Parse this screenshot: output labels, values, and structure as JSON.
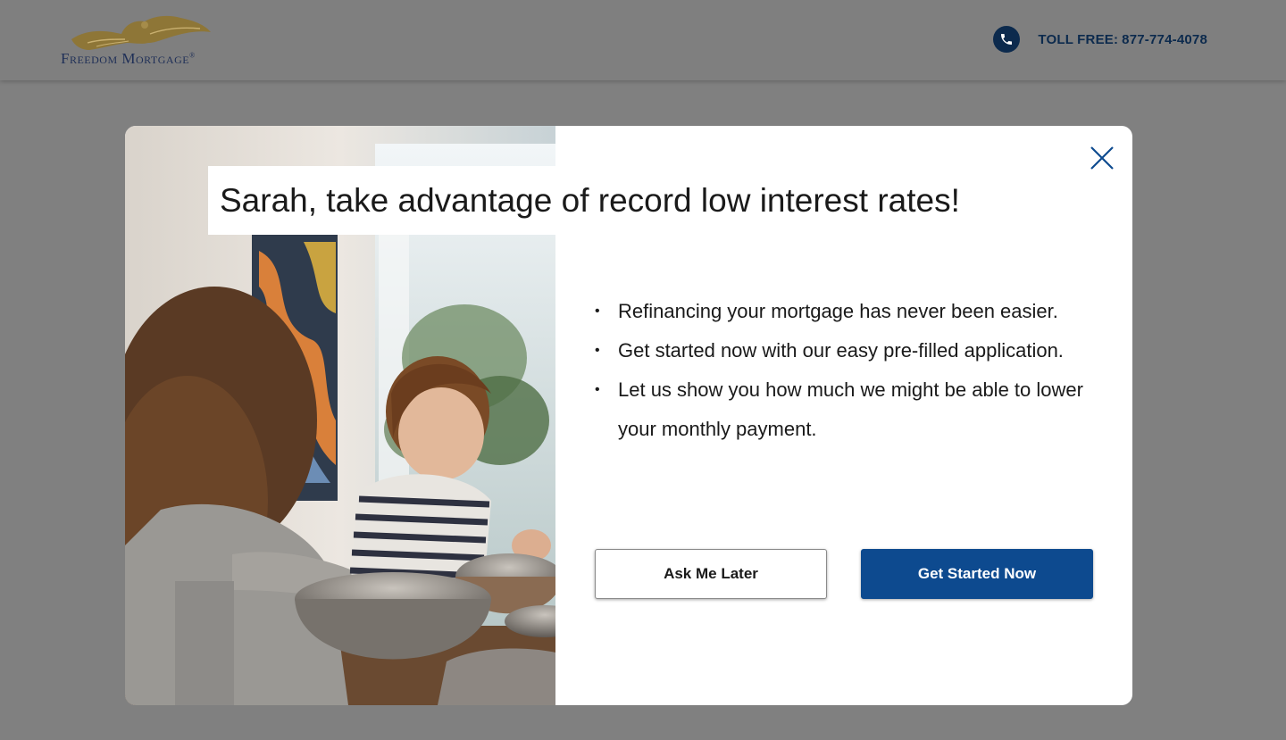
{
  "header": {
    "logo_text": "Freedom Mortgage",
    "logo_mark": "®",
    "phone_label": "TOLL FREE:",
    "phone_number": "877-774-4078",
    "phone_icon": "phone-icon"
  },
  "modal": {
    "headline": "Sarah, take advantage of record low interest rates!",
    "close_icon": "close-icon",
    "bullets": [
      "Refinancing your mortgage has never been easier.",
      "Get started now with our easy pre-filled application.",
      "Let us show you how much we might be able to lower your monthly payment."
    ],
    "ask_later_label": "Ask Me Later",
    "get_started_label": "Get Started Now"
  },
  "colors": {
    "brand_blue": "#0d4a8f",
    "navy": "#0c2a4d",
    "gold": "#a0894a",
    "overlay": "#808080"
  }
}
